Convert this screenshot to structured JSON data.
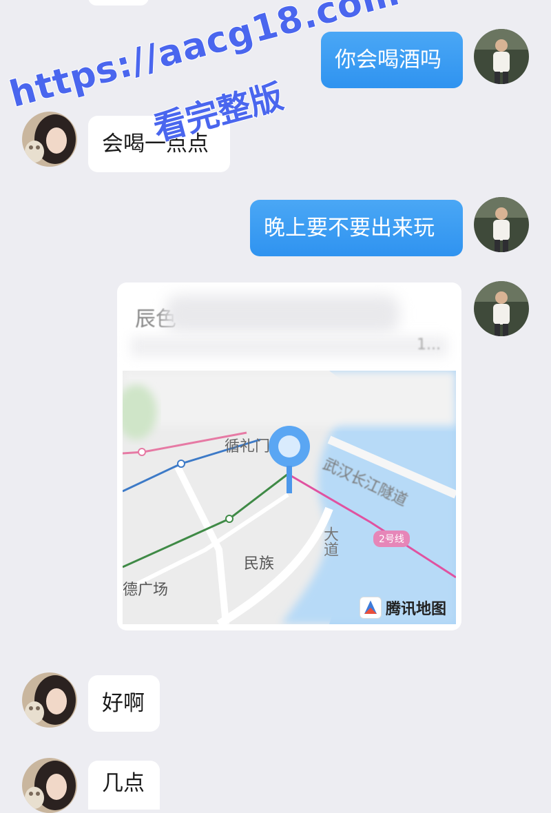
{
  "watermark": {
    "url": "https://aacg18.com",
    "subtitle": "看完整版"
  },
  "messages": [
    {
      "side": "right",
      "text": "你会喝酒吗"
    },
    {
      "side": "left",
      "text": "会喝一点点"
    },
    {
      "side": "right",
      "text": "晚上要不要出来玩"
    },
    {
      "side": "right",
      "type": "location"
    },
    {
      "side": "left",
      "text": "好啊"
    },
    {
      "side": "left",
      "text": "几点"
    }
  ],
  "location_card": {
    "title_visible": "辰色",
    "address_tail": "1...",
    "map_labels": {
      "xunlimen": "循礼门",
      "wuhan_tunnel": "武汉长江隧道",
      "road": "大道",
      "minzu": "民族",
      "square": "德广场",
      "line2": "2号线"
    },
    "brand": "腾讯地图"
  },
  "colors": {
    "background": "#ededf2",
    "outgoing_bubble": "#3a9cf2",
    "incoming_bubble": "#ffffff",
    "watermark": "#4a66ee"
  }
}
